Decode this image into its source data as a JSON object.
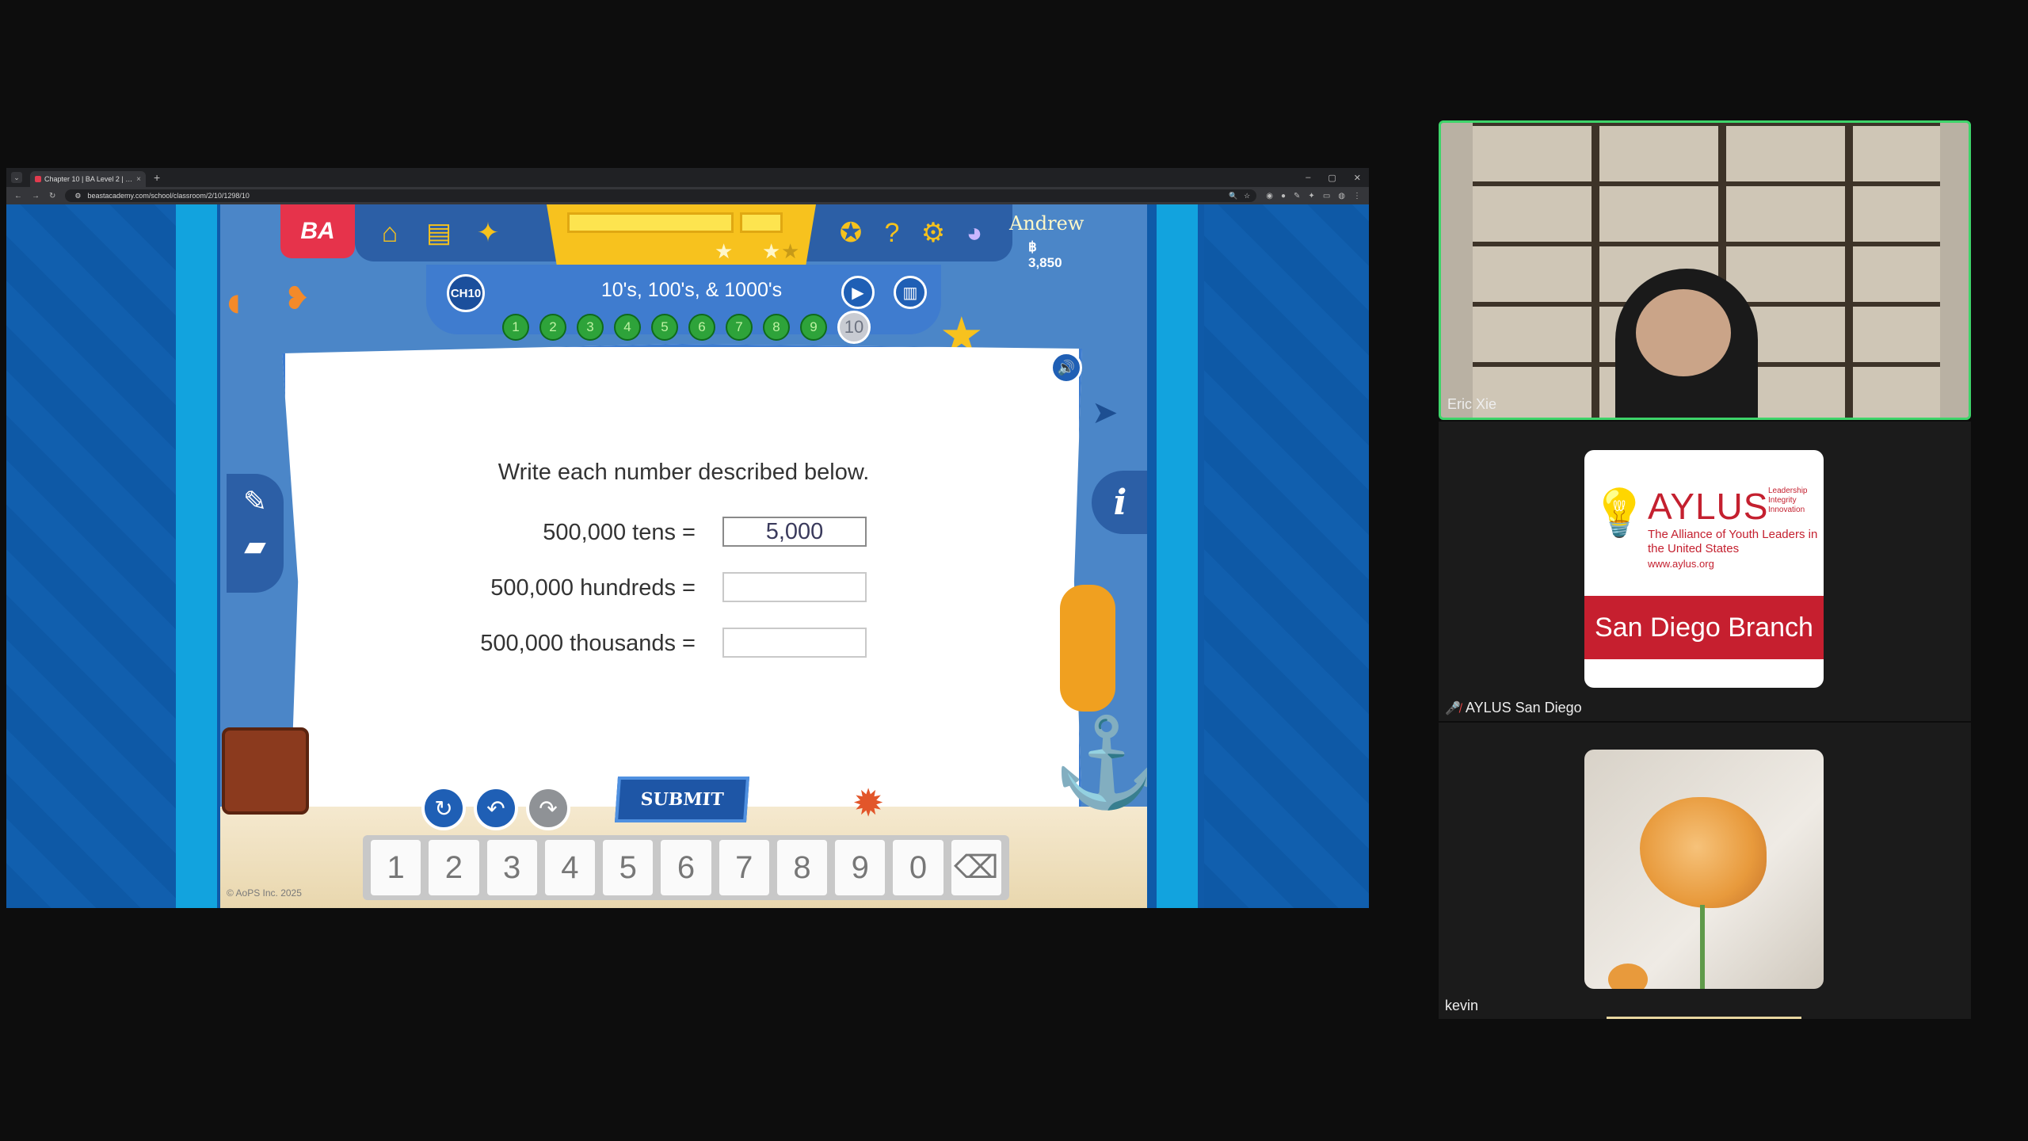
{
  "browser": {
    "tab_title": "Chapter 10 | BA Level 2 | Classr",
    "new_tab": "+",
    "url": "beastacademy.com/school/classroom/2/10/1298/10",
    "window_controls": [
      "–",
      "▢",
      "✕"
    ]
  },
  "game": {
    "logo": "BA",
    "user_name": "Andrew",
    "coins": "฿ 3,850",
    "chapter_badge": "CH10",
    "lesson_title": "10's, 100's, & 1000's",
    "levels": [
      "1",
      "2",
      "3",
      "4",
      "5",
      "6",
      "7",
      "8",
      "9",
      "10"
    ],
    "current_level": "10",
    "prompt": "Write each number described below.",
    "questions": [
      {
        "label": "500,000 tens =",
        "value": "5,000"
      },
      {
        "label": "500,000 hundreds =",
        "value": ""
      },
      {
        "label": "500,000 thousands =",
        "value": ""
      }
    ],
    "submit_label": "SUBMIT",
    "keypad": [
      "1",
      "2",
      "3",
      "4",
      "5",
      "6",
      "7",
      "8",
      "9",
      "0"
    ],
    "backspace_icon": "⌫",
    "info_icon": "i",
    "copyright": "© AoPS Inc. 2025"
  },
  "participants": [
    {
      "name": "Eric Xie",
      "active": true
    },
    {
      "name": "AYLUS San Diego",
      "muted": true
    },
    {
      "name": "kevin"
    }
  ],
  "aylus": {
    "title": "AYLUS",
    "tagline": [
      "Leadership",
      "Integrity",
      "Innovation"
    ],
    "subtitle": "The Alliance of Youth Leaders in the United States",
    "url": "www.aylus.org",
    "branch": "San Diego Branch"
  },
  "colors": {
    "speaking_border": "#3ed46a",
    "game_blue": "#2c5fa6",
    "level_green": "#2ea33a",
    "aylus_red": "#c61f2f"
  }
}
